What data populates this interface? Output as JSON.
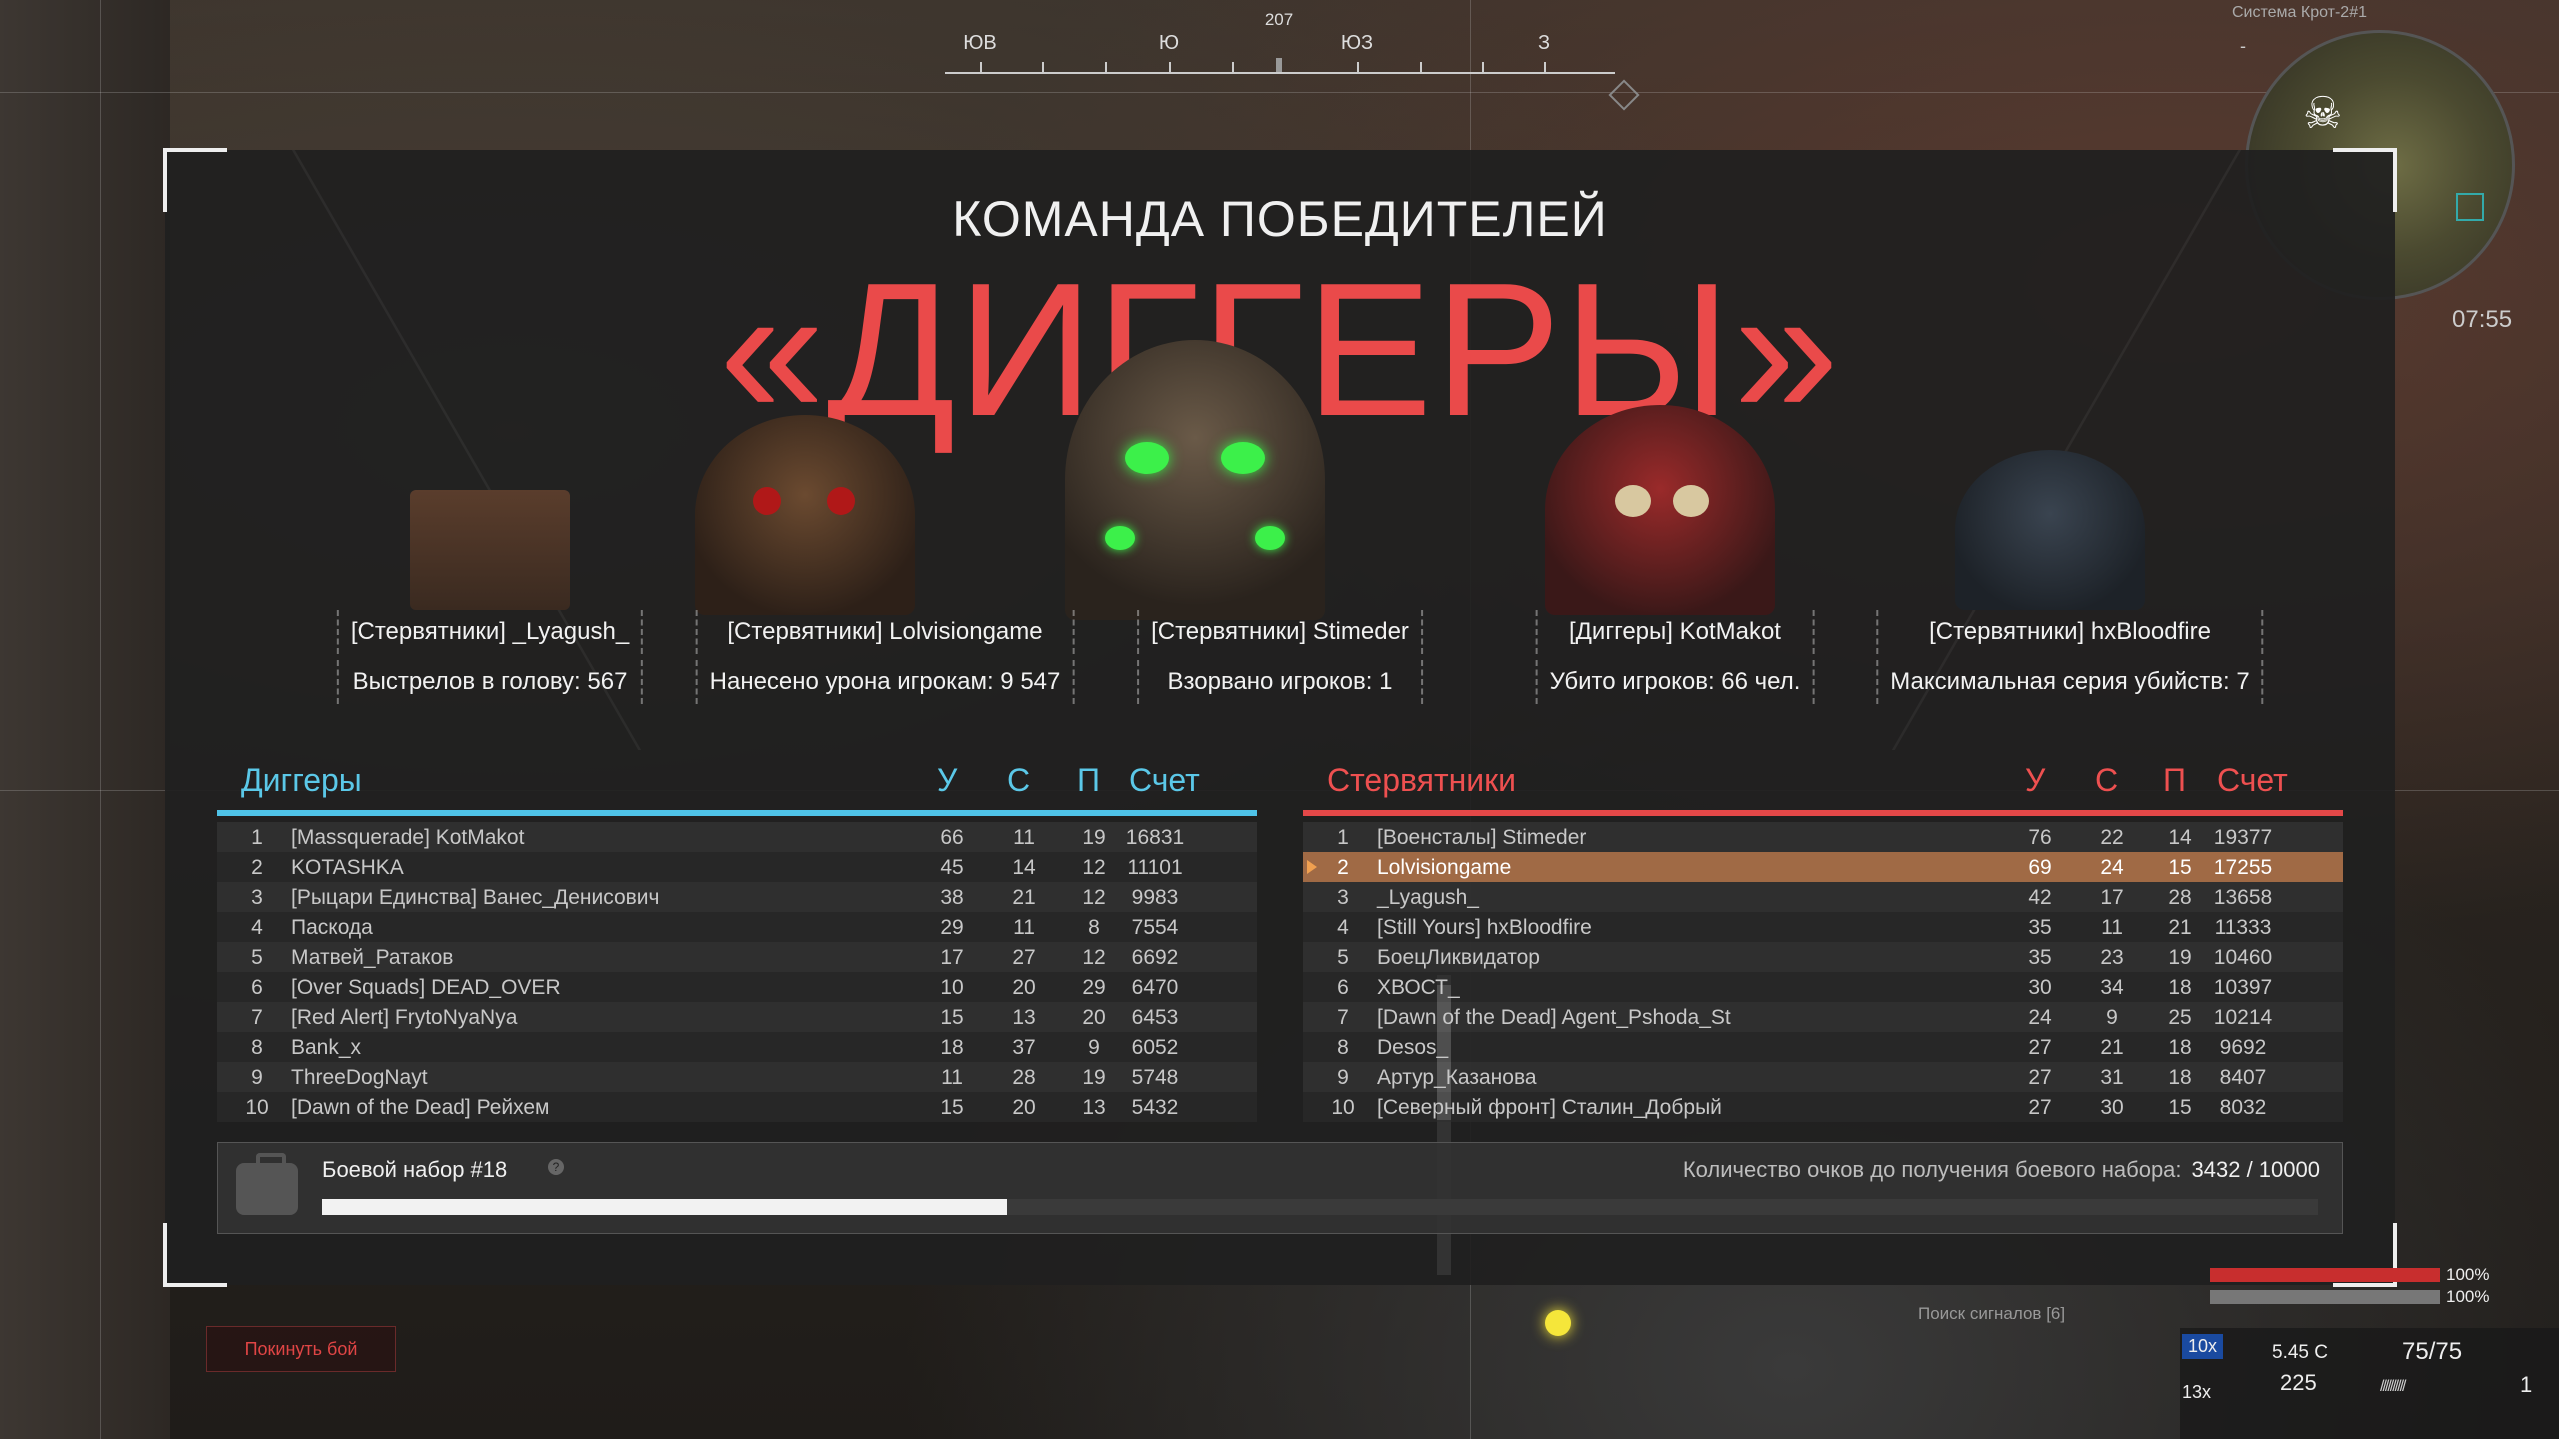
{
  "compass": {
    "heading": "207",
    "labels": [
      {
        "text": "ЮВ"
      },
      {
        "text": "Ю"
      },
      {
        "text": "ЮЗ"
      },
      {
        "text": "З"
      }
    ]
  },
  "minimap": {
    "title": "Система Крот-2#1",
    "zoom_out": "-",
    "time": "07:55"
  },
  "winner": {
    "subtitle": "КОМАНДА ПОБЕДИТЕЛЕЙ",
    "team": "«ДИГГЕРЫ»"
  },
  "awards": [
    {
      "player": "[Стервятники] _Lyagush_",
      "stat": "Выстрелов в голову: 567"
    },
    {
      "player": "[Стервятники] Lolvisiongame",
      "stat": "Нанесено урона игрокам: 9 547"
    },
    {
      "player": "[Стервятники] Stimeder",
      "stat": "Взорвано игроков: 1"
    },
    {
      "player": "[Диггеры] KotMakot",
      "stat": "Убито игроков: 66 чел."
    },
    {
      "player": "[Стервятники] hxBloodfire",
      "stat": "Максимальная серия убийств: 7"
    }
  ],
  "columns": {
    "kills": "У",
    "deaths": "С",
    "assists": "П",
    "score": "Счет"
  },
  "team_left": {
    "name": "Диггеры",
    "color": "#5bc8e8",
    "rows": [
      {
        "rank": "1",
        "name": "[Massquerade] KotMakot",
        "k": "66",
        "d": "11",
        "a": "19",
        "score": "16831"
      },
      {
        "rank": "2",
        "name": "KOTASHKA",
        "k": "45",
        "d": "14",
        "a": "12",
        "score": "11101"
      },
      {
        "rank": "3",
        "name": "[Рыцари Единства] Ванес_Денисович",
        "k": "38",
        "d": "21",
        "a": "12",
        "score": "9983"
      },
      {
        "rank": "4",
        "name": "Паскода",
        "k": "29",
        "d": "11",
        "a": "8",
        "score": "7554"
      },
      {
        "rank": "5",
        "name": "Матвей_Ратаков",
        "k": "17",
        "d": "27",
        "a": "12",
        "score": "6692"
      },
      {
        "rank": "6",
        "name": "[Over Squads] DEAD_OVER",
        "k": "10",
        "d": "20",
        "a": "29",
        "score": "6470"
      },
      {
        "rank": "7",
        "name": "[Red Alert] FrytoNyaNya",
        "k": "15",
        "d": "13",
        "a": "20",
        "score": "6453"
      },
      {
        "rank": "8",
        "name": "Bank_x",
        "k": "18",
        "d": "37",
        "a": "9",
        "score": "6052"
      },
      {
        "rank": "9",
        "name": "ThreeDogNayt",
        "k": "11",
        "d": "28",
        "a": "19",
        "score": "5748"
      },
      {
        "rank": "10",
        "name": "[Dawn of the Dead] Рейхем",
        "k": "15",
        "d": "20",
        "a": "13",
        "score": "5432"
      }
    ]
  },
  "team_right": {
    "name": "Стервятники",
    "color": "#ee5050",
    "rows": [
      {
        "rank": "1",
        "name": "[Военсталы] Stimeder",
        "k": "76",
        "d": "22",
        "a": "14",
        "score": "19377"
      },
      {
        "rank": "2",
        "name": "Lolvisiongame",
        "k": "69",
        "d": "24",
        "a": "15",
        "score": "17255",
        "highlight": true
      },
      {
        "rank": "3",
        "name": "_Lyagush_",
        "k": "42",
        "d": "17",
        "a": "28",
        "score": "13658"
      },
      {
        "rank": "4",
        "name": "[Still Yours] hxBloodfire",
        "k": "35",
        "d": "11",
        "a": "21",
        "score": "11333"
      },
      {
        "rank": "5",
        "name": "БоецЛиквидатор",
        "k": "35",
        "d": "23",
        "a": "19",
        "score": "10460"
      },
      {
        "rank": "6",
        "name": "ХВОСТ_",
        "k": "30",
        "d": "34",
        "a": "18",
        "score": "10397"
      },
      {
        "rank": "7",
        "name": "[Dawn of the Dead] Agent_Pshoda_St",
        "k": "24",
        "d": "9",
        "a": "25",
        "score": "10214"
      },
      {
        "rank": "8",
        "name": "Desos_",
        "k": "27",
        "d": "21",
        "a": "18",
        "score": "9692"
      },
      {
        "rank": "9",
        "name": "Артур_Казанова",
        "k": "27",
        "d": "31",
        "a": "18",
        "score": "8407"
      },
      {
        "rank": "10",
        "name": "[Северный фронт] Сталин_Добрый",
        "k": "27",
        "d": "30",
        "a": "15",
        "score": "8032"
      }
    ]
  },
  "battle_pack": {
    "title": "Боевой набор #18",
    "info": "?",
    "req_label": "Количество очков до получения боевого набора:",
    "req_value": "3432 / 10000",
    "progress": 0.3432
  },
  "hud": {
    "leave_button": "Покинуть бой",
    "signal": "Поиск сигналов [6]",
    "health_pct": "100%",
    "stamina_pct": "100%",
    "scope": "10x",
    "ammo_count": "13x",
    "ammo_type": "5.45 С",
    "ammo_reserve": "225",
    "durability": "75/75",
    "grenades": "1"
  }
}
